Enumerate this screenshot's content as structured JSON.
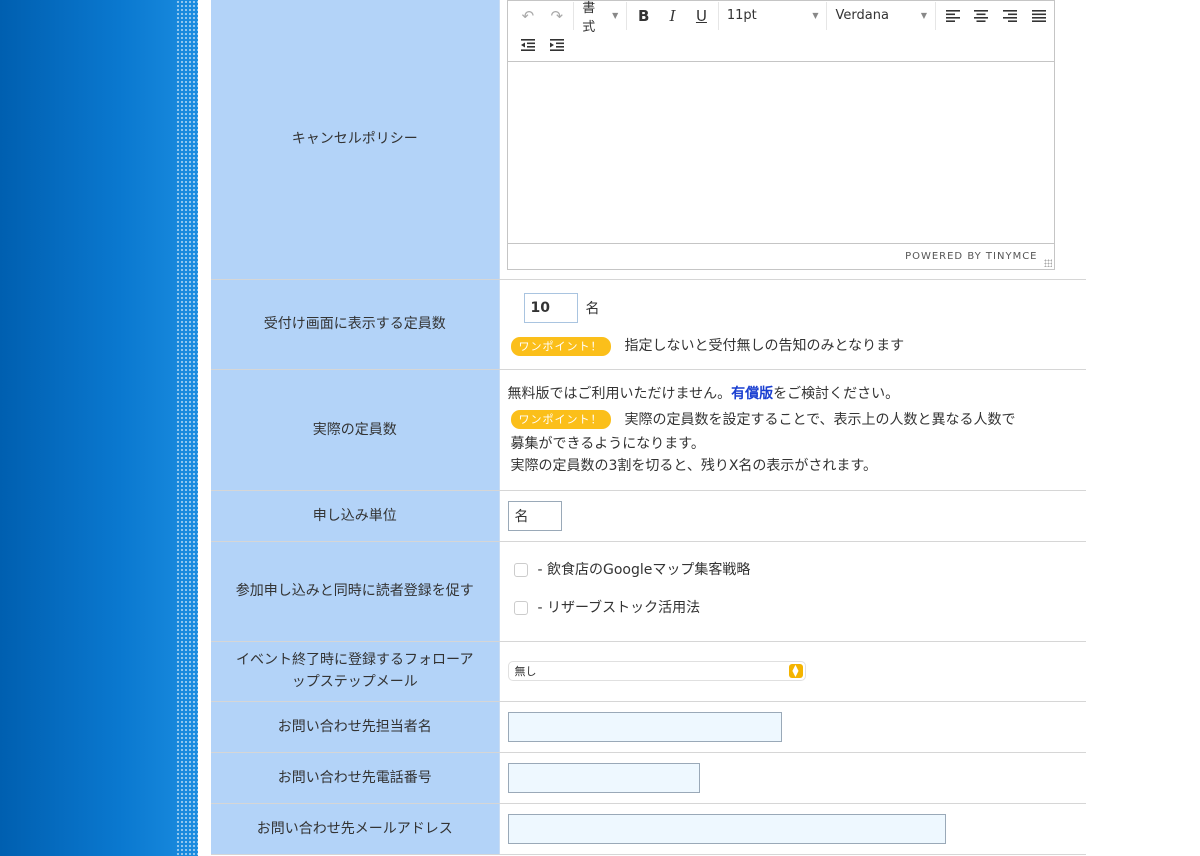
{
  "editor": {
    "format_label": "書式",
    "font_size": "11pt",
    "font_family": "Verdana",
    "powered_by": "POWERED BY TINYMCE"
  },
  "rows": {
    "cancel_policy": {
      "label": "キャンセルポリシー"
    },
    "display_capacity": {
      "label": "受付け画面に表示する定員数",
      "value": "10",
      "unit": "名",
      "badge": "ワンポイント！",
      "note": "指定しないと受付無しの告知のみとなります"
    },
    "actual_capacity": {
      "label": "実際の定員数",
      "line1_before": "無料版ではご利用いただけません。",
      "line1_link": "有償版",
      "line1_after": "をご検討ください。",
      "badge": "ワンポイント！",
      "note1": "実際の定員数を設定することで、表示上の人数と異なる人数で",
      "note2": "募集ができるようになります。",
      "note3": "実際の定員数の3割を切ると、残りX名の表示がされます。"
    },
    "unit": {
      "label": "申し込み単位",
      "value": "名"
    },
    "reader_registration": {
      "label": "参加申し込みと同時に読者登録を促す",
      "options": [
        "- 飲食店のGoogleマップ集客戦略",
        "- リザーブストック活用法"
      ]
    },
    "followup_mail": {
      "label_line1": "イベント終了時に登録するフォローア",
      "label_line2": "ップステップメール",
      "selected": "無し"
    },
    "contact_person": {
      "label": "お問い合わせ先担当者名"
    },
    "contact_phone": {
      "label": "お問い合わせ先電話番号"
    },
    "contact_email": {
      "label": "お問い合わせ先メールアドレス"
    }
  },
  "colors": {
    "label_bg": "#b3d3f8",
    "badge": "#fbbf1a",
    "link": "#1a3fd1",
    "side_band": "#0a78cf"
  }
}
